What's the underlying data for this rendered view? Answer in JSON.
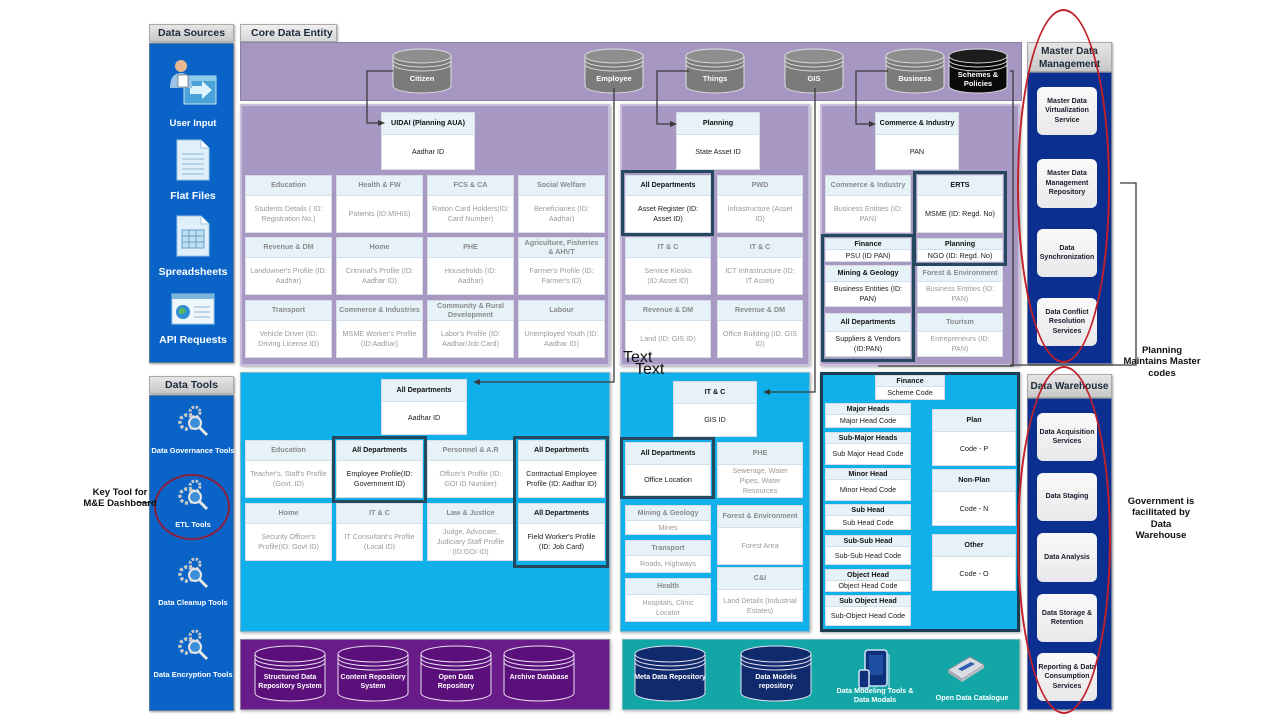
{
  "data_sources": {
    "title": "Data Sources",
    "items": [
      {
        "label": "User Input",
        "icon": "user-input-icon"
      },
      {
        "label": "Flat Files",
        "icon": "flat-file-icon"
      },
      {
        "label": "Spreadsheets",
        "icon": "spreadsheet-icon"
      },
      {
        "label": "API Requests",
        "icon": "api-request-icon"
      }
    ]
  },
  "data_tools": {
    "title": "Data Tools",
    "items": [
      {
        "label": "Data Governance Tools",
        "icon": "gears-search-icon"
      },
      {
        "label": "ETL Tools",
        "icon": "gears-search-icon"
      },
      {
        "label": "Data Cleanup Tools",
        "icon": "gears-search-icon"
      },
      {
        "label": "Data Encryption Tools",
        "icon": "gears-search-icon"
      }
    ],
    "etl_note": "Key Tool for M&E Dashboard"
  },
  "core": {
    "title": "Core Data Entity",
    "entities": [
      "Citizen",
      "Employee",
      "Things",
      "GIS",
      "Business",
      "Schemes & Policies"
    ],
    "citizen_panel": {
      "anchor": {
        "header": "UIDAI (Planning AUA)",
        "body": "Aadhar ID"
      },
      "cards": [
        {
          "header": "Education",
          "body": "Students Details ( ID: Registration No.)"
        },
        {
          "header": "Health & FW",
          "body": "Patients (ID:MIHIS)"
        },
        {
          "header": "FCS & CA",
          "body": "Ration Card Holders(ID: Card Number)"
        },
        {
          "header": "Social Welfare",
          "body": "Beneficiaries (ID: Aadhar)"
        },
        {
          "header": "Revenue & DM",
          "body": "Landowner's Profile (ID: Aadhar)"
        },
        {
          "header": "Home",
          "body": "Criminal's Profile (ID: Aadhar ID)"
        },
        {
          "header": "PHE",
          "body": "Households (ID: Aadhar)"
        },
        {
          "header": "Agriculture, Fisheries & AHVT",
          "body": "Farmer's Profile (ID: Farmer's ID)"
        },
        {
          "header": "Transport",
          "body": "Vehicle Driver (ID: Driving License ID)"
        },
        {
          "header": "Commerce & Industries",
          "body": "MSME Worker's Profile (ID:Aadhar)"
        },
        {
          "header": "Community & Rural Development",
          "body": "Labor's Profile (ID: Aadhar/Job Card)"
        },
        {
          "header": "Labour",
          "body": "Unemployed Youth (ID: Aadhar ID)"
        }
      ]
    },
    "things_panel": {
      "anchor": {
        "header": "Planning",
        "body": "State Asset ID"
      },
      "cards": [
        {
          "header": "All Departments",
          "body": "Asset Register (ID: Asset ID)"
        },
        {
          "header": "PWD",
          "body": "Infrastructure (Asset ID)"
        },
        {
          "header": "IT & C",
          "body": "Service Kiosks (ID:Asset ID)"
        },
        {
          "header": "IT & C",
          "body": "ICT Infrastructure (ID: IT Asset)"
        },
        {
          "header": "Revenue & DM",
          "body": "Land (ID: GIS ID)"
        },
        {
          "header": "Revenue & DM",
          "body": "Office Building (ID: GIS ID)"
        }
      ]
    },
    "business_panel": {
      "anchor": {
        "header": "Commerce & Industry",
        "body": "PAN"
      },
      "cards": [
        {
          "header": "Commerce & Industry",
          "body": "Business Entities (ID: PAN)"
        },
        {
          "header": "ERTS",
          "body": "MSME (ID: Regd. No)"
        },
        {
          "header": "Finance",
          "body": "PSU (ID PAN)"
        },
        {
          "header": "Planning",
          "body": "NGO (ID: Regd. No)"
        },
        {
          "header": "Mining & Geology",
          "body": "Business Entities (ID: PAN)"
        },
        {
          "header": "Forest & Environment",
          "body": "Business Entities (ID: PAN)"
        },
        {
          "header": "All Departments",
          "body": "Suppliers & Vendors (ID:PAN)"
        },
        {
          "header": "Tourism",
          "body": "Entrepreneurs (ID: PAN)"
        }
      ]
    },
    "employee_panel": {
      "anchor": {
        "header": "All Departments",
        "body": "Aadhar ID"
      },
      "cards": [
        {
          "header": "Education",
          "body": "Teacher's, Staff's Profile (Govt. ID)"
        },
        {
          "header": "All Departments",
          "body": "Employee Profile(ID: Government ID)"
        },
        {
          "header": "Personnel & A.R",
          "body": "Officer's Profile (ID: GOI ID Number)"
        },
        {
          "header": "All Departments",
          "body": "Contractual Employee Profile (ID: Aadhar ID)"
        },
        {
          "header": "Home",
          "body": "Security Officer's Profile(ID: Govt ID)"
        },
        {
          "header": "IT & C",
          "body": "IT Consultant's Profile (Local ID)"
        },
        {
          "header": "Law & Justice",
          "body": "Judge, Advocate, Judiciary Staff Profile (ID:GOI ID)"
        },
        {
          "header": "All Departments",
          "body": "Field Worker's Profile (ID: Job Card)"
        }
      ]
    },
    "gis_panel": {
      "overlay_text": [
        "Text",
        "Text"
      ],
      "anchor": {
        "header": "IT & C",
        "body": "GIS ID"
      },
      "cards": [
        {
          "header": "All Departments",
          "body": "Office Location"
        },
        {
          "header": "PHE",
          "body": "Sewerage, Water Pipes, Water Resources"
        },
        {
          "header": "Mining & Geology",
          "body": "Mines"
        },
        {
          "header": "Forest & Environment",
          "body": "Forest Area"
        },
        {
          "header": "Transport",
          "body": "Roads, Highways"
        },
        {
          "header": "C&I",
          "body": "Land Details (Industrial Estates)"
        },
        {
          "header": "Health",
          "body": "Hospitals, Clinic Locator"
        }
      ]
    },
    "schemes_panel": {
      "anchor": {
        "header": "Finance",
        "body": "Scheme Code"
      },
      "heads": [
        {
          "header": "Major Heads",
          "body": "Major Head Code"
        },
        {
          "header": "Sub-Major Heads",
          "body": "Sub Major Head Code"
        },
        {
          "header": "Minor Head",
          "body": "Minor Head Code"
        },
        {
          "header": "Sub Head",
          "body": "Sub Head Code"
        },
        {
          "header": "Sub-Sub Head",
          "body": "Sub-Sub Head Code"
        },
        {
          "header": "Object Head",
          "body": "Object Head Code"
        },
        {
          "header": "Sub Object Head",
          "body": "Sub-Object Head Code"
        }
      ],
      "plan_codes": [
        {
          "header": "Plan",
          "body": "Code - P"
        },
        {
          "header": "Non-Plan",
          "body": "Code - N"
        },
        {
          "header": "Other",
          "body": "Code - O"
        }
      ]
    }
  },
  "repositories": {
    "left": [
      "Structured Data Repository System",
      "Content Repository System",
      "Open Data Repository",
      "Archive Database"
    ],
    "right": [
      "Meta Data Repository",
      "Data Models repository"
    ],
    "tools": [
      {
        "label": "Data Modeling Tools & Data Modals",
        "icon": "data-modeling-device-icon"
      },
      {
        "label": "Open Data Catalogue",
        "icon": "data-catalogue-device-icon"
      }
    ]
  },
  "mdm": {
    "title": "Master Data Management",
    "services": [
      "Master Data Virtualization Service",
      "Master Data Management Repository",
      "Data Synchronization",
      "Data Conflict Resolution Services"
    ],
    "note": "Planning Maintains Master codes"
  },
  "warehouse": {
    "title": "Data Warehouse",
    "services": [
      "Data Acquisition Services",
      "Data Staging",
      "Data Analysis",
      "Data Storage & Retention",
      "Reporting & Data Consumption Services"
    ],
    "note": "Government is facilitated by Data Warehouse"
  },
  "colors": {
    "source_blue": "#0a64c8",
    "navy": "#0b2f91",
    "core_purple": "#a697c2",
    "cyan": "#10b0ea",
    "repo_purple": "#6a1b8a",
    "repo_teal": "#12a6a6",
    "highlight": "#24495e",
    "annotation_red": "#c0202a"
  }
}
